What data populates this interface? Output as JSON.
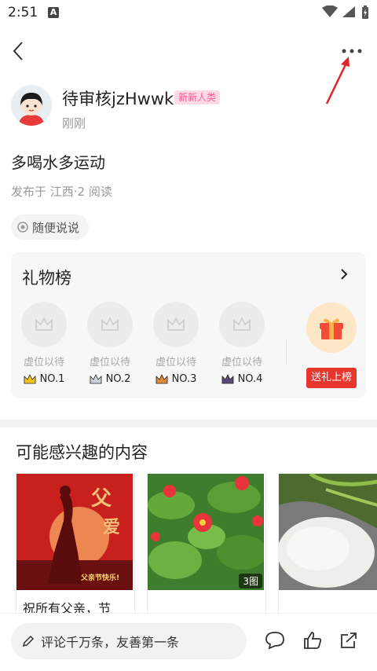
{
  "status_bar": {
    "time": "2:51",
    "app_badge": "A"
  },
  "post": {
    "author": "待审核jzHwwk",
    "author_badge": "新新人类",
    "time": "刚刚",
    "content": "多喝水多运动",
    "meta": "发布于 江西·2 阅读",
    "topic": "随便说说"
  },
  "gift_board": {
    "title": "礼物榜",
    "seats": [
      {
        "label": "虚位以待",
        "rank": "NO.1",
        "crown_color": "#f5c518"
      },
      {
        "label": "虚位以待",
        "rank": "NO.2",
        "crown_color": "#9aa6b2"
      },
      {
        "label": "虚位以待",
        "rank": "NO.3",
        "crown_color": "#e08a3c"
      },
      {
        "label": "虚位以待",
        "rank": "NO.4",
        "crown_color": "#5a4a7a"
      }
    ],
    "send_button": "送礼上榜"
  },
  "recommend": {
    "title": "可能感兴趣的内容",
    "cards": [
      {
        "caption": "祝所有父亲，节",
        "poster_text": "父亲节快乐!"
      },
      {
        "caption": "",
        "img_count": "3图"
      },
      {
        "caption": ""
      }
    ]
  },
  "bottom_bar": {
    "comment_placeholder": "评论千万条，友善第一条"
  },
  "colors": {
    "accent_red": "#e8362d",
    "badge_pink": "#ff5b8f"
  }
}
